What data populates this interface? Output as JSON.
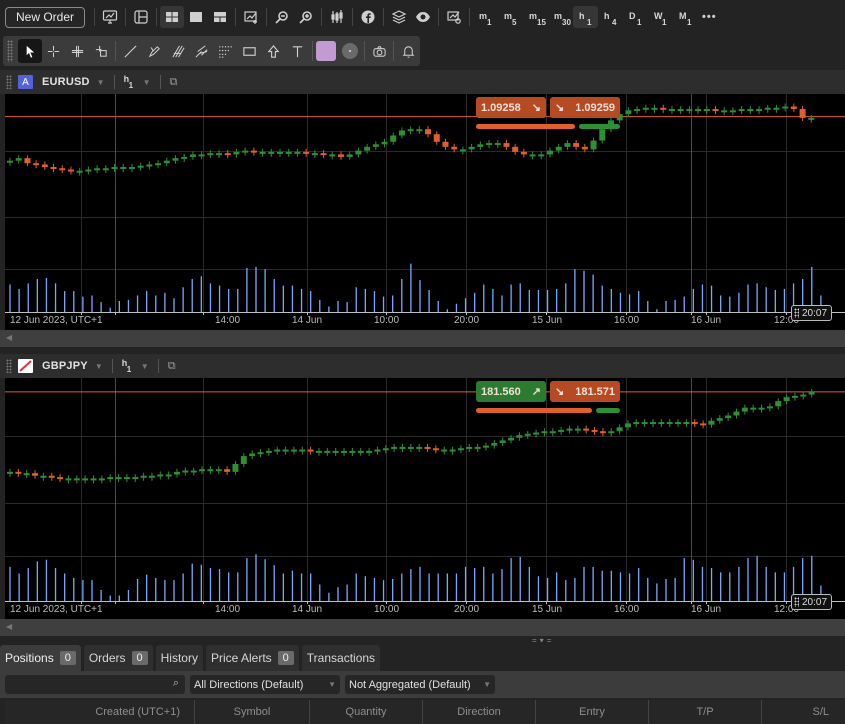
{
  "toolbar": {
    "new_order_label": "New Order",
    "icons": [
      "monitor-chart-icon",
      "layout-icon",
      "grid-4-icon",
      "single-layout-icon",
      "split-layout-icon",
      "add-chart-icon",
      "zoom-out-icon",
      "zoom-in-icon",
      "candles-icon",
      "facebook-icon",
      "layers-icon",
      "eye-icon",
      "chart-settings-icon"
    ],
    "timeframes": [
      {
        "unit": "m",
        "num": "1",
        "active": false
      },
      {
        "unit": "m",
        "num": "5",
        "active": false
      },
      {
        "unit": "m",
        "num": "15",
        "active": false
      },
      {
        "unit": "m",
        "num": "30",
        "active": false
      },
      {
        "unit": "h",
        "num": "1",
        "active": true
      },
      {
        "unit": "h",
        "num": "4",
        "active": false
      },
      {
        "unit": "D",
        "num": "1",
        "active": false
      },
      {
        "unit": "W",
        "num": "1",
        "active": false
      },
      {
        "unit": "M",
        "num": "1",
        "active": false
      }
    ],
    "more_label": "•••"
  },
  "drawing_tools": {
    "active": "pointer",
    "tools": [
      "pointer",
      "crosshair",
      "crosshair-plus",
      "crosshair-box",
      "line",
      "pencil",
      "fibonacci",
      "pitchfork",
      "pattern",
      "rectangle",
      "arrow-up",
      "text"
    ],
    "color": "#c39bd3"
  },
  "charts": [
    {
      "symbol": "EURUSD",
      "badge": "A",
      "timeframe_unit": "h",
      "timeframe_num": "1",
      "sell_price": "1.09258",
      "buy_price": "1.09259",
      "sell_color": "red",
      "buy_color": "red",
      "last_time": "20:07",
      "x_labels": [
        "12 Jun 2023, UTC+1",
        "14:00",
        "14 Jun",
        "10:00",
        "20:00",
        "15 Jun",
        "16:00",
        "16 Jun",
        "12:00"
      ],
      "price_line_level": 0.9,
      "candles": [
        0.55,
        0.57,
        0.53,
        0.52,
        0.5,
        0.49,
        0.48,
        0.47,
        0.47,
        0.48,
        0.49,
        0.49,
        0.5,
        0.5,
        0.5,
        0.51,
        0.52,
        0.53,
        0.55,
        0.57,
        0.58,
        0.6,
        0.6,
        0.61,
        0.61,
        0.6,
        0.62,
        0.63,
        0.62,
        0.62,
        0.62,
        0.62,
        0.62,
        0.62,
        0.61,
        0.61,
        0.6,
        0.6,
        0.58,
        0.6,
        0.63,
        0.66,
        0.68,
        0.7,
        0.75,
        0.79,
        0.8,
        0.8,
        0.76,
        0.7,
        0.66,
        0.64,
        0.64,
        0.66,
        0.68,
        0.69,
        0.69,
        0.66,
        0.62,
        0.6,
        0.6,
        0.6,
        0.63,
        0.66,
        0.69,
        0.66,
        0.64,
        0.71,
        0.8,
        0.87,
        0.92,
        0.95,
        0.96,
        0.97,
        0.97,
        0.96,
        0.96,
        0.96,
        0.96,
        0.96,
        0.96,
        0.95,
        0.95,
        0.95,
        0.96,
        0.96,
        0.96,
        0.97,
        0.97,
        0.98,
        0.96,
        0.89,
        0.89
      ],
      "volumes": [
        0.5,
        0.42,
        0.52,
        0.6,
        0.62,
        0.52,
        0.38,
        0.38,
        0.28,
        0.3,
        0.18,
        0.08,
        0.2,
        0.22,
        0.3,
        0.38,
        0.3,
        0.35,
        0.25,
        0.45,
        0.6,
        0.65,
        0.52,
        0.48,
        0.42,
        0.42,
        0.8,
        0.82,
        0.78,
        0.6,
        0.48,
        0.48,
        0.42,
        0.38,
        0.22,
        0.1,
        0.2,
        0.18,
        0.45,
        0.42,
        0.38,
        0.28,
        0.3,
        0.6,
        0.88,
        0.58,
        0.4,
        0.2,
        0.05,
        0.15,
        0.25,
        0.35,
        0.5,
        0.42,
        0.3,
        0.5,
        0.52,
        0.4,
        0.4,
        0.4,
        0.42,
        0.52,
        0.78,
        0.75,
        0.68,
        0.48,
        0.42,
        0.35,
        0.32,
        0.38,
        0.2,
        0.05,
        0.2,
        0.22,
        0.28,
        0.42,
        0.5,
        0.48,
        0.3,
        0.28,
        0.35,
        0.5,
        0.52,
        0.45,
        0.4,
        0.42,
        0.52,
        0.6,
        0.82,
        0.3
      ]
    },
    {
      "symbol": "GBPJPY",
      "badge": "",
      "timeframe_unit": "h",
      "timeframe_num": "1",
      "sell_price": "181.560",
      "buy_price": "181.571",
      "sell_color": "green",
      "buy_color": "red",
      "last_time": "20:07",
      "x_labels": [
        "12 Jun 2023, UTC+1",
        "14:00",
        "14 Jun",
        "10:00",
        "20:00",
        "15 Jun",
        "16:00",
        "16 Jun",
        "12:00"
      ],
      "price_line_level": 0.97,
      "candles": [
        0.36,
        0.35,
        0.35,
        0.33,
        0.33,
        0.32,
        0.31,
        0.31,
        0.31,
        0.31,
        0.31,
        0.31,
        0.32,
        0.32,
        0.32,
        0.32,
        0.33,
        0.33,
        0.34,
        0.34,
        0.36,
        0.37,
        0.37,
        0.38,
        0.38,
        0.38,
        0.36,
        0.42,
        0.48,
        0.5,
        0.51,
        0.52,
        0.53,
        0.53,
        0.53,
        0.53,
        0.52,
        0.52,
        0.52,
        0.52,
        0.52,
        0.52,
        0.52,
        0.52,
        0.53,
        0.54,
        0.55,
        0.55,
        0.55,
        0.55,
        0.54,
        0.53,
        0.53,
        0.53,
        0.54,
        0.55,
        0.55,
        0.56,
        0.58,
        0.6,
        0.62,
        0.64,
        0.65,
        0.66,
        0.67,
        0.67,
        0.68,
        0.69,
        0.69,
        0.68,
        0.67,
        0.66,
        0.67,
        0.7,
        0.73,
        0.74,
        0.74,
        0.74,
        0.74,
        0.74,
        0.74,
        0.74,
        0.73,
        0.72,
        0.75,
        0.77,
        0.79,
        0.82,
        0.85,
        0.85,
        0.85,
        0.86,
        0.9,
        0.93,
        0.94,
        0.95,
        0.97
      ],
      "volumes": [
        0.62,
        0.5,
        0.6,
        0.72,
        0.75,
        0.6,
        0.5,
        0.42,
        0.38,
        0.38,
        0.2,
        0.1,
        0.1,
        0.2,
        0.4,
        0.48,
        0.42,
        0.38,
        0.38,
        0.5,
        0.68,
        0.66,
        0.6,
        0.58,
        0.52,
        0.52,
        0.78,
        0.85,
        0.76,
        0.65,
        0.5,
        0.55,
        0.5,
        0.5,
        0.3,
        0.15,
        0.25,
        0.3,
        0.5,
        0.45,
        0.42,
        0.38,
        0.4,
        0.5,
        0.58,
        0.62,
        0.5,
        0.5,
        0.5,
        0.5,
        0.62,
        0.6,
        0.62,
        0.5,
        0.58,
        0.78,
        0.8,
        0.62,
        0.45,
        0.42,
        0.52,
        0.38,
        0.42,
        0.62,
        0.62,
        0.55,
        0.55,
        0.52,
        0.5,
        0.6,
        0.42,
        0.32,
        0.4,
        0.42,
        0.78,
        0.75,
        0.62,
        0.6,
        0.52,
        0.52,
        0.62,
        0.78,
        0.82,
        0.62,
        0.52,
        0.52,
        0.62,
        0.78,
        0.82,
        0.28
      ]
    }
  ],
  "bottom": {
    "tabs": [
      {
        "label": "Positions",
        "count": "0",
        "active": true
      },
      {
        "label": "Orders",
        "count": "0",
        "active": false
      },
      {
        "label": "History",
        "count": null,
        "active": false
      },
      {
        "label": "Price Alerts",
        "count": "0",
        "active": false
      },
      {
        "label": "Transactions",
        "count": null,
        "active": false
      }
    ],
    "search_placeholder": "",
    "direction_filter": "All Directions (Default)",
    "aggregation_filter": "Not Aggregated (Default)",
    "columns": [
      "Created (UTC+1)",
      "Symbol",
      "Quantity",
      "Direction",
      "Entry",
      "T/P",
      "S/L"
    ]
  },
  "colors": {
    "up": "#2d8f36",
    "down": "#e0602c",
    "volume": "#7aa8ff",
    "price_line": "#e0602c",
    "grid": "#2a2a2a"
  }
}
